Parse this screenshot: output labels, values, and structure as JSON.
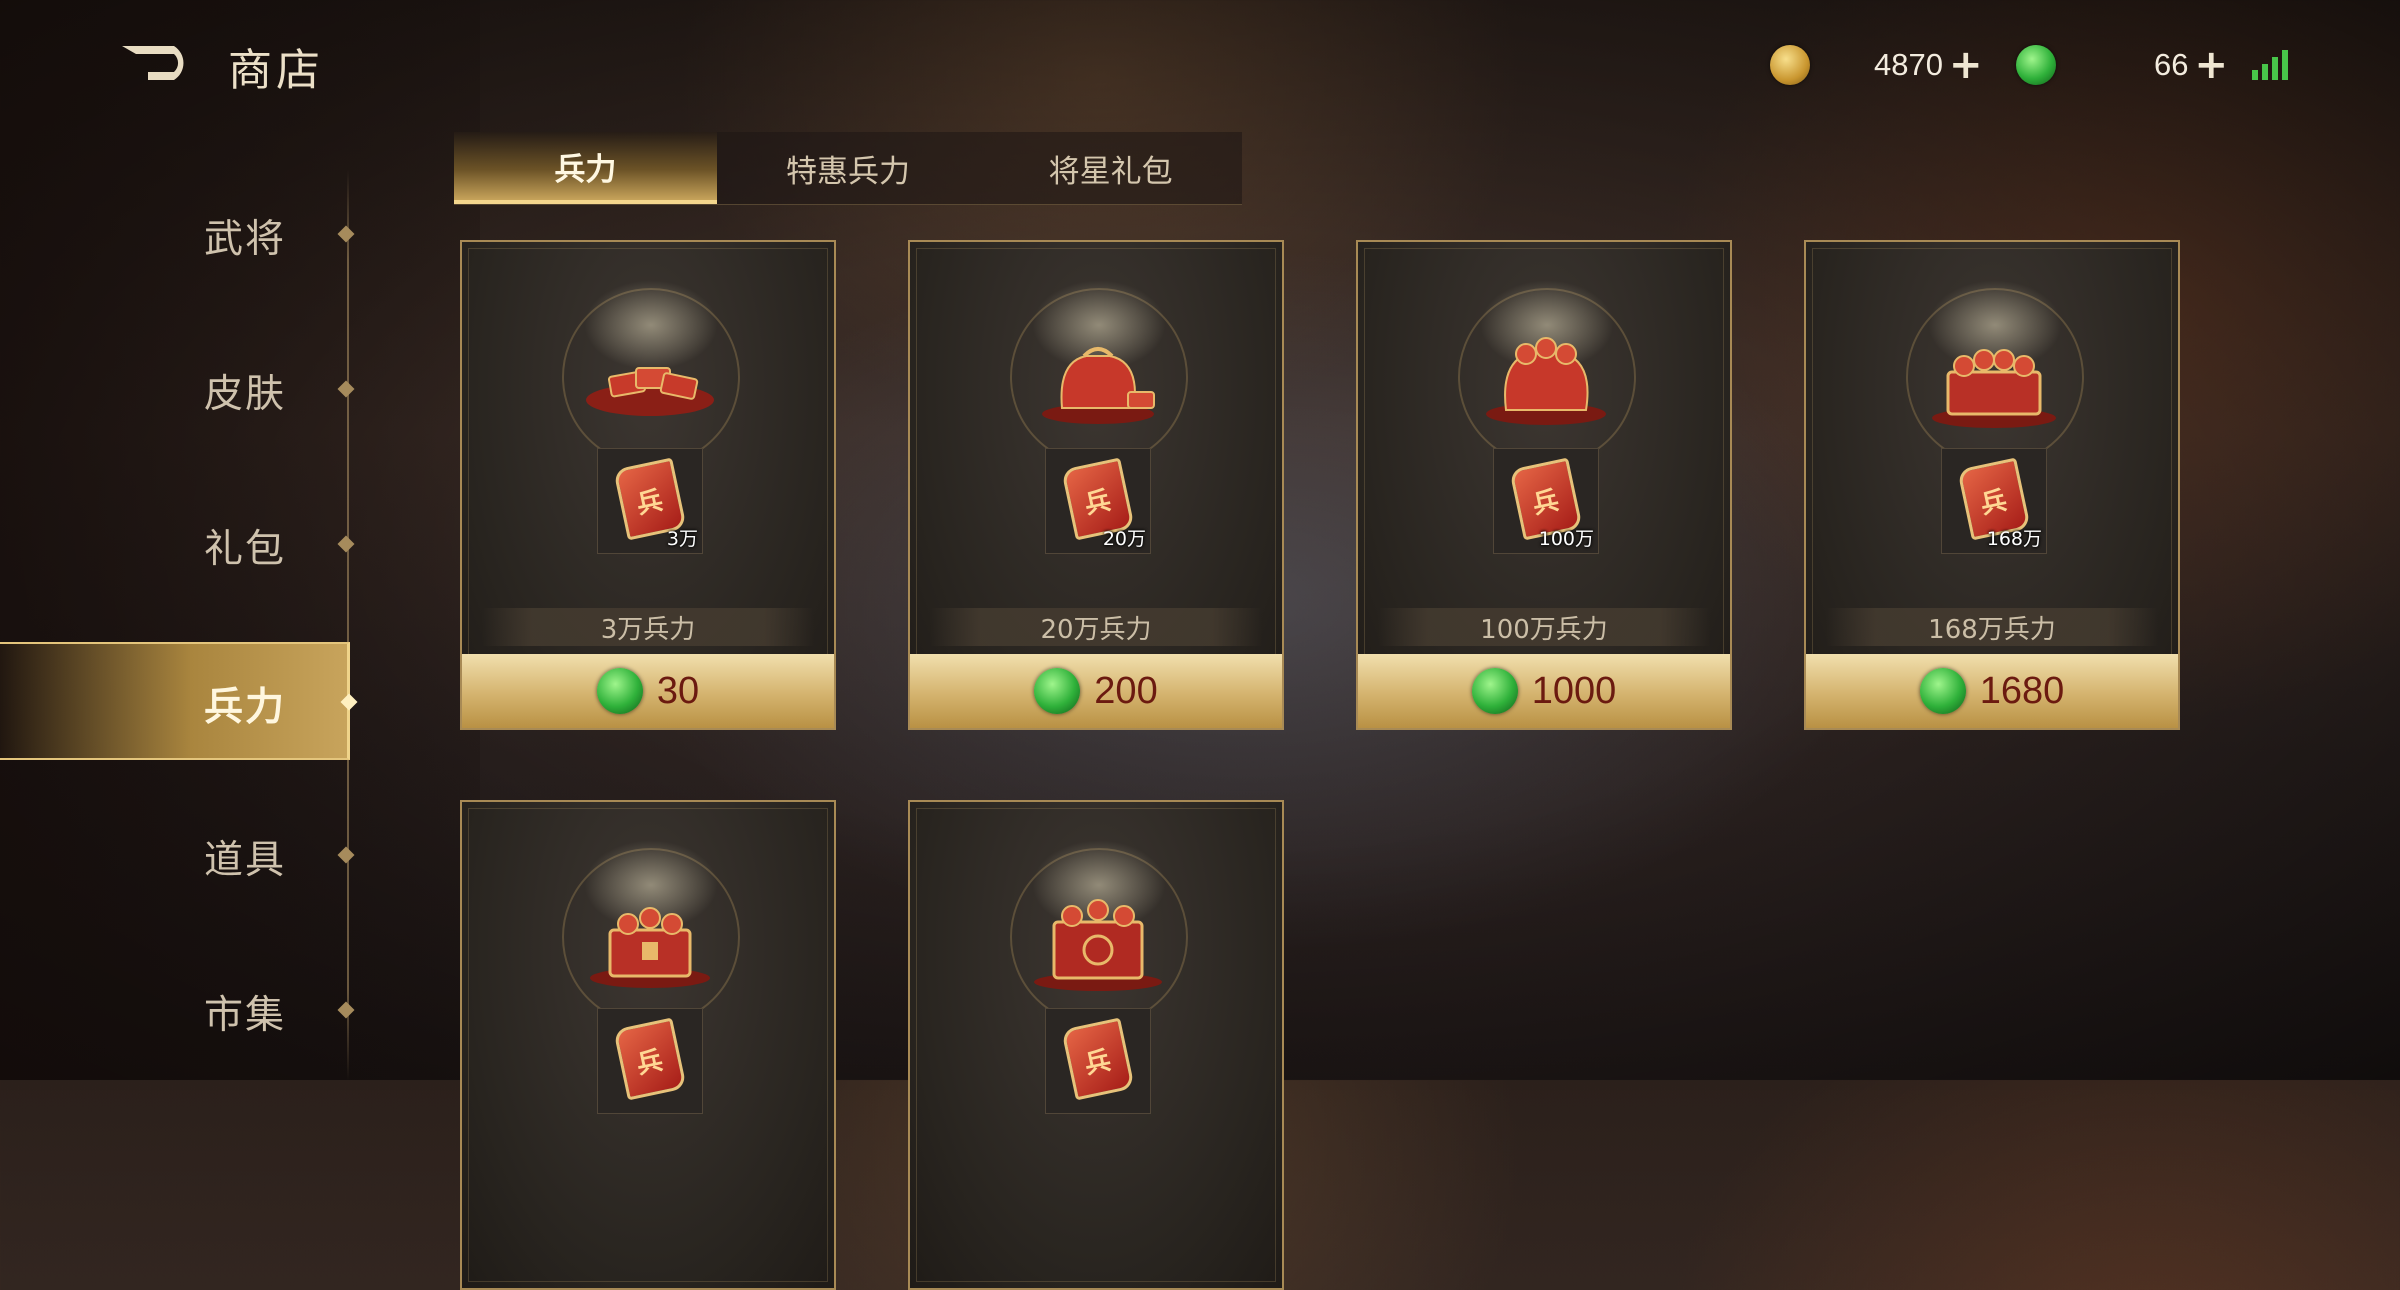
{
  "header": {
    "title": "商店",
    "gold_amount": "4870",
    "jade_amount": "66",
    "plus_symbol": "+"
  },
  "sidebar": {
    "items": [
      {
        "label": "武将"
      },
      {
        "label": "皮肤"
      },
      {
        "label": "礼包"
      },
      {
        "label": "兵力",
        "active": true
      },
      {
        "label": "道具"
      },
      {
        "label": "市集"
      }
    ]
  },
  "tabs": [
    {
      "label": "兵力",
      "active": true
    },
    {
      "label": "特惠兵力"
    },
    {
      "label": "将星礼包"
    }
  ],
  "products": [
    {
      "quantity": "3万",
      "name": "3万兵力",
      "price": "30"
    },
    {
      "quantity": "20万",
      "name": "20万兵力",
      "price": "200"
    },
    {
      "quantity": "100万",
      "name": "100万兵力",
      "price": "1000"
    },
    {
      "quantity": "168万",
      "name": "168万兵力",
      "price": "1680"
    },
    {
      "quantity": "",
      "name": "",
      "price": ""
    },
    {
      "quantity": "",
      "name": "",
      "price": ""
    }
  ],
  "colors": {
    "accent_gold": "#d4b36e",
    "price_text": "#6b1a10",
    "signal_green": "#48c64a"
  }
}
